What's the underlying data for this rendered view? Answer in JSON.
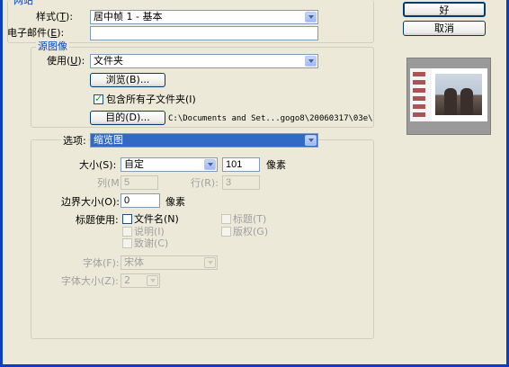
{
  "site": {
    "legend": "网站",
    "style_label": "样式(",
    "style_key": "T",
    "style_value": "居中帧 1 - 基本",
    "email_label": "电子邮件(",
    "email_key": "E",
    "email_value": ""
  },
  "source": {
    "legend": "源图像",
    "use_label": "使用(",
    "use_key": "U",
    "use_value": "文件夹",
    "browse_label": "浏览(B)...",
    "include_subfolders_label": "包含所有子文件夹(I)",
    "include_subfolders_checked": true,
    "destination_label": "目的(D)...",
    "destination_path": "C:\\Documents and Set...gogo8\\20060317\\03e\\"
  },
  "options": {
    "label": "选项:",
    "value": "缩览图",
    "size_label": "大小(S):",
    "size_value": "自定",
    "size_number": "101",
    "size_unit": "像素",
    "columns_label": "列(M):",
    "columns_value": "5",
    "rows_label": "行(R):",
    "rows_value": "3",
    "border_label": "边界大小(O):",
    "border_value": "0",
    "border_unit": "像素",
    "titles_label": "标题使用:",
    "filename_label": "文件名(N)",
    "title_label": "标题(T)",
    "caption_label": "说明(I)",
    "copyright_label": "版权(G)",
    "credits_label": "致谢(C)",
    "font_label": "字体(F):",
    "font_value": "宋体",
    "font_size_label": "字体大小(Z):",
    "font_size_value": "2"
  },
  "buttons": {
    "ok_label": "好",
    "cancel_label": "取消"
  },
  "colors": {
    "accent": "#316ac5",
    "legend": "#0046d5",
    "window_bg": "#ece9d8"
  }
}
